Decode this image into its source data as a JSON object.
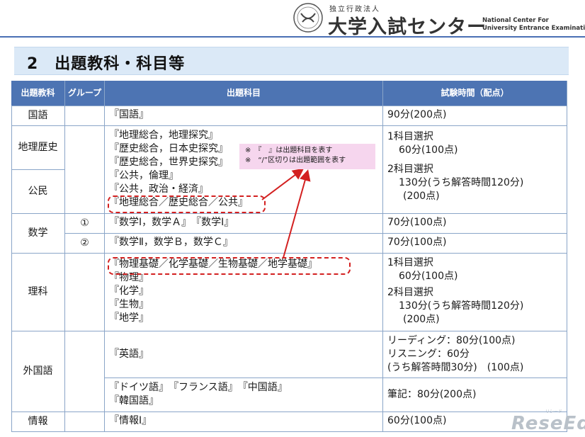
{
  "header": {
    "org_prefix": "独立行政法人",
    "org_name": "大学入試センター",
    "org_en_line1": "National Center For",
    "org_en_line2": "University Entrance Examinations"
  },
  "section": {
    "title": "2　出題教科・科目等"
  },
  "table": {
    "headers": [
      "出題教科",
      "グループ",
      "出題科目",
      "試験時間（配点）"
    ],
    "kokugo": {
      "subject": "国語",
      "items": "『国語』",
      "time": "90分(200点)"
    },
    "chireki": {
      "subject": "地理歴史"
    },
    "koumin": {
      "subject": "公民"
    },
    "social_items": [
      "『地理総合，地理探究』",
      "『歴史総合，日本史探究』",
      "『歴史総合，世界史探究』",
      "『公共，倫理』",
      "『公共，政治・経済』",
      "『地理総合／歴史総合／公共』"
    ],
    "social_time": {
      "one": "1科目選択",
      "one_detail": "60分(100点)",
      "two": "2科目選択",
      "two_detail": "130分(うち解答時間120分)",
      "two_points": "(200点)"
    },
    "math": {
      "subject": "数学",
      "groups": [
        {
          "group": "①",
          "items": "『数学Ⅰ，数学Ａ』　『数学Ⅰ』",
          "time": "70分(100点)"
        },
        {
          "group": "②",
          "items": "『数学Ⅱ，数学Ｂ，数学Ｃ』",
          "time": "70分(100点)"
        }
      ]
    },
    "science": {
      "subject": "理科",
      "items": [
        "『物理基礎／化学基礎／生物基礎／地学基礎』",
        "『物理』",
        "『化学』",
        "『生物』",
        "『地学』"
      ],
      "time": {
        "one": "1科目選択",
        "one_detail": "60分(100点)",
        "two": "2科目選択",
        "two_detail": "130分(うち解答時間120分)",
        "two_points": "(200点)"
      }
    },
    "foreign": {
      "subject": "外国語",
      "english_items": "『英語』",
      "english_time": [
        "リーディング：80分(100点)",
        "リスニング：60分",
        "(うち解答時間30分)　(100点)"
      ],
      "other_items_line1": "『ドイツ語』　『フランス語』　『中国語』",
      "other_items_line2": "『韓国語』",
      "other_time": "筆記：80分(200点)"
    },
    "info": {
      "subject": "情報",
      "items": "『情報Ⅰ』",
      "time": "60分(100点)"
    }
  },
  "note": {
    "line1": "※　『　』は出題科目を表す",
    "line2": "※　“/”区切りは出題範囲を表す"
  },
  "watermark": {
    "text": "ReseEd",
    "small": "リシード"
  }
}
